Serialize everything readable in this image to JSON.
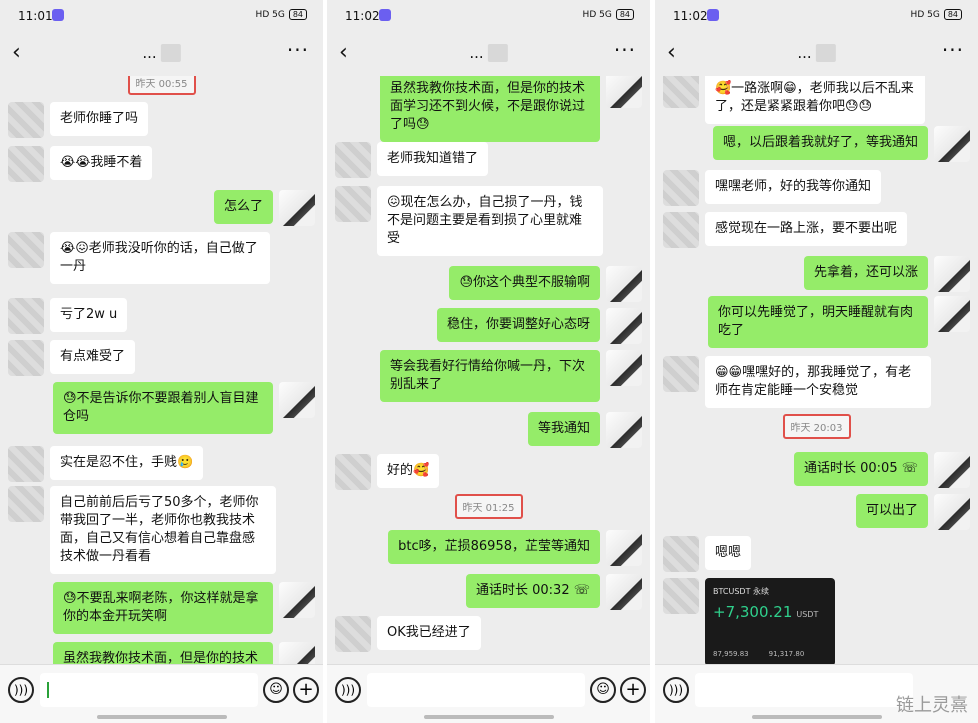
{
  "status_bar": [
    {
      "time": "11:01",
      "signal": "HD 5G",
      "battery": "84"
    },
    {
      "time": "11:02",
      "signal": "HD 5G",
      "battery": "84"
    },
    {
      "time": "11:02",
      "signal": "HD 5G",
      "battery": "84"
    }
  ],
  "header": {
    "back_icon": "chevron-left-icon",
    "more_icon": "more-dots-icon",
    "titles": [
      "...",
      "...",
      "..."
    ]
  },
  "colors": {
    "bg": "#ededed",
    "my_bubble": "#95ec69",
    "their_bubble": "#ffffff",
    "highlight_box": "#e0504a",
    "profit_green": "#2fd08c"
  },
  "panel1": {
    "timestamp": "昨天 00:55",
    "messages": [
      {
        "side": "left",
        "text": "老师你睡了吗"
      },
      {
        "side": "left",
        "text": "😭😭我睡不着"
      },
      {
        "side": "right",
        "text": "怎么了"
      },
      {
        "side": "left",
        "text": "😭😖老师我没听你的话，自己做了一丹"
      },
      {
        "side": "left",
        "text": "亏了2w u"
      },
      {
        "side": "left",
        "text": "有点难受了"
      },
      {
        "side": "right",
        "text": "😓不是告诉你不要跟着别人盲目建仓吗"
      },
      {
        "side": "left",
        "text": "实在是忍不住，手贱🥲"
      },
      {
        "side": "left",
        "text": "自己前前后后亏了50多个，老师你带我回了一半，老师你也教我技术面，自己又有信心想着自己靠盘感技术做一丹看看"
      },
      {
        "side": "right",
        "text": "😓不要乱来啊老陈，你这样就是拿你的本金开玩笑啊"
      },
      {
        "side": "right",
        "text": "虽然我教你技术面，但是你的技术"
      }
    ]
  },
  "panel2": {
    "timestamp": "昨天 01:25",
    "messages": [
      {
        "side": "right",
        "text": "虽然我教你技术面，但是你的技术面学习还不到火候，不是跟你说过了吗😓"
      },
      {
        "side": "left",
        "text": "老师我知道错了"
      },
      {
        "side": "left",
        "text": "😖现在怎么办，自己损了一丹，钱不是问题主要是看到损了心里就难受"
      },
      {
        "side": "right",
        "text": "😓你这个典型不服输啊"
      },
      {
        "side": "right",
        "text": "稳住，你要调整好心态呀"
      },
      {
        "side": "right",
        "text": "等会我看好行情给你喊一丹，下次别乱来了"
      },
      {
        "side": "right",
        "text": "等我通知"
      },
      {
        "side": "left",
        "text": "好的🥰"
      },
      {
        "side": "right",
        "text": "btc哆，芷损86958，芷莹等通知"
      },
      {
        "side": "right",
        "text": "通话时长 00:32 ☏"
      },
      {
        "side": "left",
        "text": "OK我已经进了"
      }
    ]
  },
  "panel3": {
    "timestamp": "昨天 20:03",
    "messages": [
      {
        "side": "left",
        "text": "🥰一路涨啊😁，老师我以后不乱来了，还是紧紧跟着你吧😓😓"
      },
      {
        "side": "right",
        "text": "嗯，以后跟着我就好了，等我通知"
      },
      {
        "side": "left",
        "text": "嘿嘿老师，好的我等你通知"
      },
      {
        "side": "left",
        "text": "感觉现在一路上涨，要不要出呢"
      },
      {
        "side": "right",
        "text": "先拿着，还可以涨"
      },
      {
        "side": "right",
        "text": "你可以先睡觉了，明天睡醒就有肉吃了"
      },
      {
        "side": "left",
        "text": "😁😁嘿嘿好的，那我睡觉了，有老师在肯定能睡一个安稳觉"
      },
      {
        "side": "right",
        "text": "通话时长 00:05 ☏"
      },
      {
        "side": "right",
        "text": "可以出了"
      },
      {
        "side": "left",
        "text": "嗯嗯"
      }
    ],
    "card": {
      "pair": "BTCUSDT 永续",
      "pnl": "+7,300.21",
      "currency": "USDT",
      "entry": "87,959.83",
      "exit": "91,317.80"
    }
  },
  "input_bar": {
    "voice_icon": "voice-icon",
    "emoji_icon": "emoji-icon",
    "plus_icon": "plus-icon"
  },
  "watermark": "链上灵熹"
}
